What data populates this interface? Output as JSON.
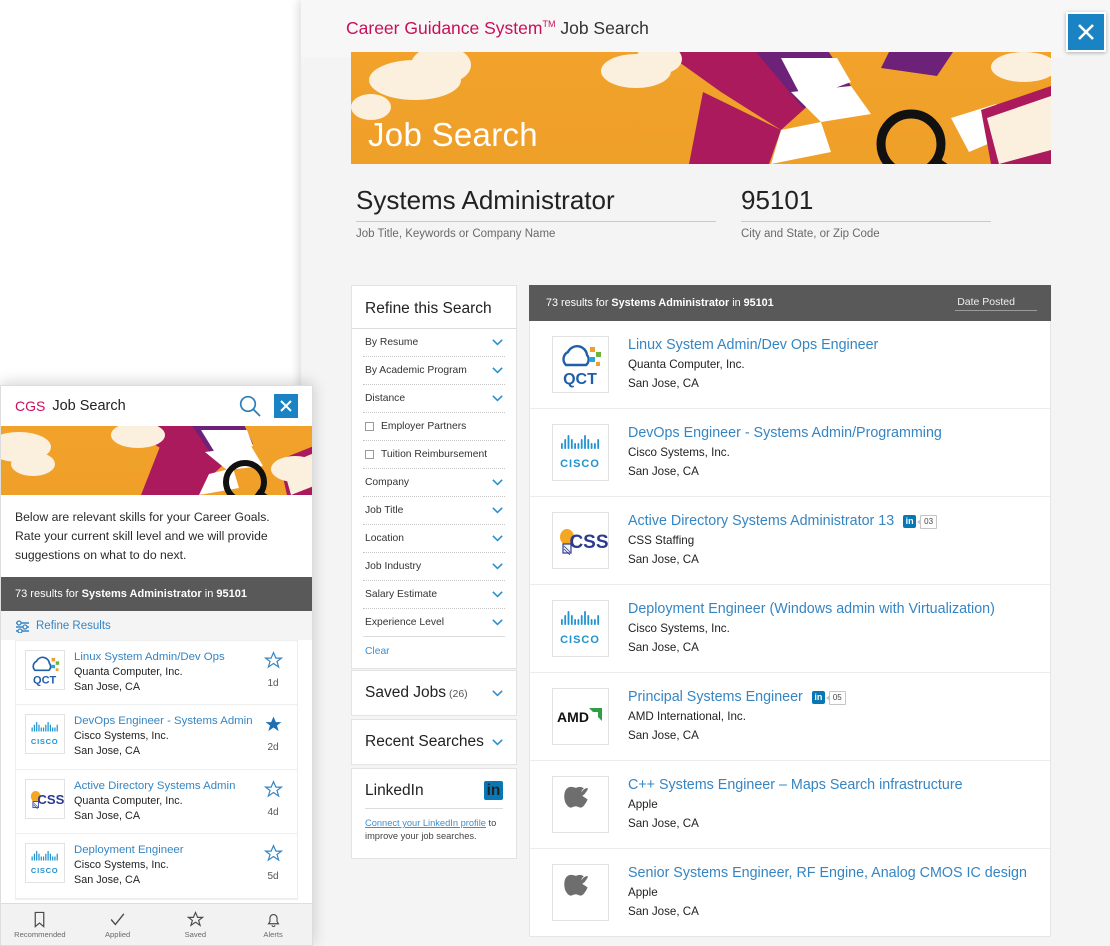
{
  "desktop": {
    "topbar": {
      "brand": "Career Guidance System",
      "tm": "TM",
      "section": "Job Search"
    },
    "hero": {
      "title": "Job Search"
    },
    "search": {
      "job_query": "Systems Administrator",
      "job_label": "Job Title, Keywords or Company Name",
      "location_query": "95101",
      "location_label": "City and State, or Zip Code"
    },
    "refine": {
      "title": "Refine this Search",
      "rows": [
        {
          "label": "By Resume",
          "type": "accordion"
        },
        {
          "label": "By Academic Program",
          "type": "accordion"
        },
        {
          "label": "Distance",
          "type": "accordion"
        },
        {
          "label": "Employer Partners",
          "type": "checkbox"
        },
        {
          "label": "Tuition Reimbursement",
          "type": "checkbox"
        },
        {
          "label": "Company",
          "type": "accordion"
        },
        {
          "label": "Job Title",
          "type": "accordion"
        },
        {
          "label": "Location",
          "type": "accordion"
        },
        {
          "label": "Job Industry",
          "type": "accordion"
        },
        {
          "label": "Salary Estimate",
          "type": "accordion"
        },
        {
          "label": "Experience Level",
          "type": "accordion"
        }
      ],
      "clear": "Clear"
    },
    "saved_jobs": {
      "label": "Saved Jobs",
      "count": "(26)"
    },
    "recent_searches": {
      "label": "Recent Searches"
    },
    "linkedin": {
      "label": "LinkedIn",
      "badge": "in",
      "link_text": "Connect your LinkedIn profile",
      "tail_text": " to improve your job searches."
    },
    "results_header": {
      "count": "73 results for",
      "query": "Systems Administrator",
      "in": "in",
      "location": "95101",
      "sort": "Date Posted"
    },
    "jobs": [
      {
        "title": "Linux System Admin/Dev Ops Engineer",
        "company": "Quanta Computer, Inc.",
        "location": "San Jose, CA",
        "logo": "qct",
        "linkedin": null
      },
      {
        "title": "DevOps Engineer - Systems Admin/Programming",
        "company": "Cisco Systems, Inc.",
        "location": "San Jose, CA",
        "logo": "cisco",
        "linkedin": null
      },
      {
        "title": "Active Directory Systems Administrator 13",
        "company": "CSS Staffing",
        "location": "San Jose, CA",
        "logo": "css",
        "linkedin": "03"
      },
      {
        "title": "Deployment Engineer (Windows admin with Virtualization)",
        "company": "Cisco Systems, Inc.",
        "location": "San Jose, CA",
        "logo": "cisco",
        "linkedin": null
      },
      {
        "title": "Principal Systems Engineer",
        "company": "AMD International, Inc.",
        "location": "San Jose, CA",
        "logo": "amd",
        "linkedin": "05"
      },
      {
        "title": "C++ Systems Engineer – Maps Search infrastructure",
        "company": "Apple",
        "location": "San Jose, CA",
        "logo": "apple",
        "linkedin": null
      },
      {
        "title": "Senior Systems Engineer, RF Engine, Analog CMOS IC design",
        "company": "Apple",
        "location": "San Jose, CA",
        "logo": "apple",
        "linkedin": null
      }
    ],
    "close_icon": "close-icon"
  },
  "mobile": {
    "logo": "CGS",
    "title": "Job Search",
    "search_icon": "search-icon",
    "close_icon": "close-icon",
    "description": "Below are relevant skills for your Career Goals. Rate your current skill level and we will provide suggestions on what to do next.",
    "results_header": {
      "count": "73 results for",
      "query": "Systems Administrator",
      "in": "in",
      "location": "95101"
    },
    "refine_label": "Refine Results",
    "jobs": [
      {
        "title": "Linux System Admin/Dev Ops",
        "company": "Quanta Computer, Inc.",
        "location": "San Jose, CA",
        "logo": "qct",
        "saved": false,
        "age": "1d"
      },
      {
        "title": "DevOps Engineer - Systems Admin",
        "company": "Cisco Systems, Inc.",
        "location": "San Jose, CA",
        "logo": "cisco",
        "saved": true,
        "age": "2d"
      },
      {
        "title": "Active Directory Systems Admin",
        "company": "Quanta Computer, Inc.",
        "location": "San Jose, CA",
        "logo": "css",
        "saved": false,
        "age": "4d"
      },
      {
        "title": "Deployment Engineer",
        "company": "Cisco Systems, Inc.",
        "location": "San Jose, CA",
        "logo": "cisco",
        "saved": false,
        "age": "5d"
      }
    ],
    "nav": [
      {
        "label": "Recommended",
        "icon": "bookmark-icon"
      },
      {
        "label": "Applied",
        "icon": "check-icon"
      },
      {
        "label": "Saved",
        "icon": "star-icon"
      },
      {
        "label": "Alerts",
        "icon": "bell-icon"
      }
    ]
  },
  "colors": {
    "brand_magenta": "#c8105a",
    "hero_orange": "#efa028",
    "link_blue": "#3585c3",
    "header_gray": "#595959",
    "linkedin_blue": "#0a77b5",
    "close_blue": "#1983c4"
  }
}
